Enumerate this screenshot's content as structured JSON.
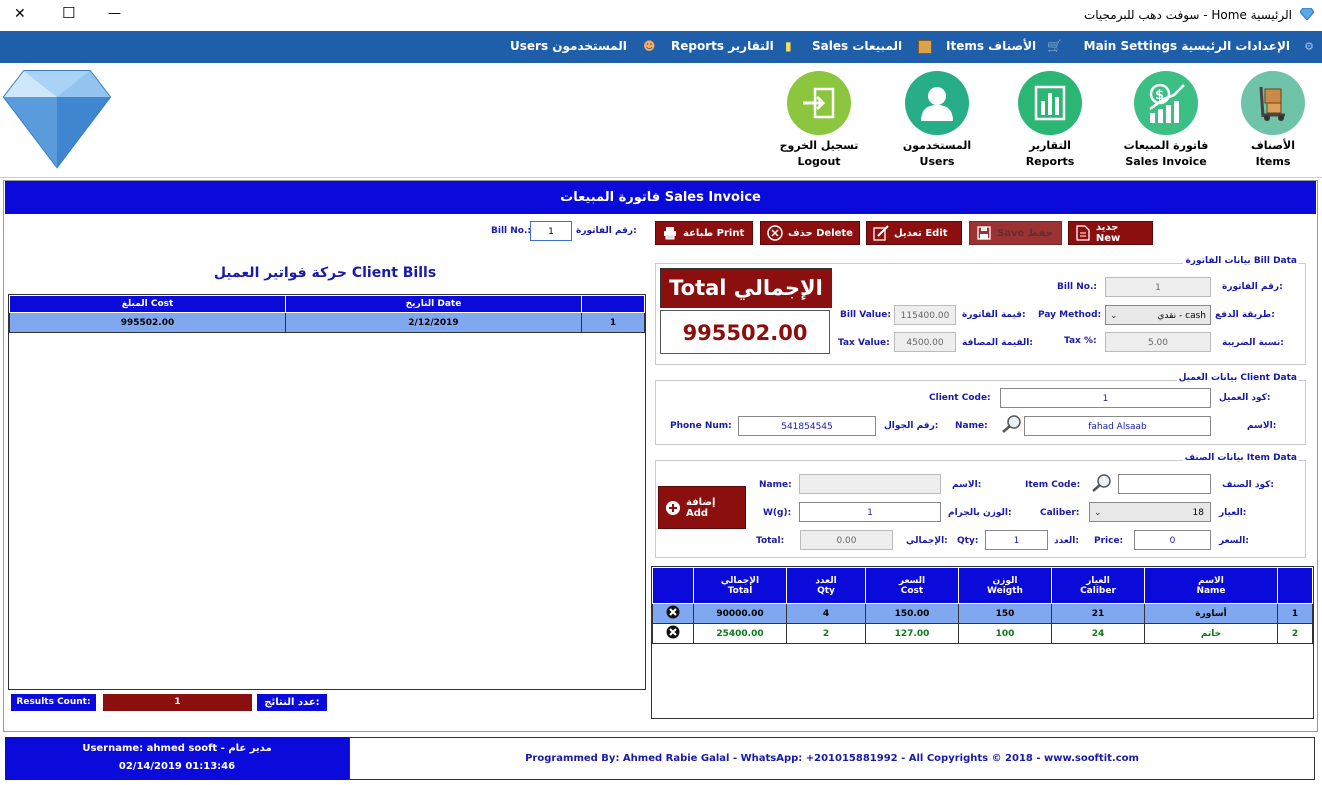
{
  "window": {
    "title": "الرئيسية Home - سوفت دهب للبرمجيات",
    "close": "✕",
    "maximize": "☐",
    "minimize": "—"
  },
  "menu": [
    {
      "label": "الإعدادات الرئيسية Main Settings"
    },
    {
      "label": "الأصناف Items"
    },
    {
      "label": "المبيعات Sales"
    },
    {
      "label": "التقارير Reports"
    },
    {
      "label": "المستخدمون Users"
    }
  ],
  "toolbar": [
    {
      "ar": "الأصناف",
      "en": "Items",
      "icon": "trolley-icon",
      "color": "#6fc3a8"
    },
    {
      "ar": "فاتورة المبيعات",
      "en": "Sales Invoice",
      "icon": "money-chart-icon",
      "color": "#3bbf85"
    },
    {
      "ar": "التقارير",
      "en": "Reports",
      "icon": "bar-chart-icon",
      "color": "#2cb673"
    },
    {
      "ar": "المستخدمون",
      "en": "Users",
      "icon": "user-icon",
      "color": "#27ad88"
    },
    {
      "ar": "تسجيل الخروج",
      "en": "Logout",
      "icon": "logout-icon",
      "color": "#8cc63f"
    }
  ],
  "page_title": "فاتورة المبيعات Sales Invoice",
  "actions": {
    "new": "جديد New",
    "save": "Save حفظ",
    "edit": "تعديل Edit",
    "delete": "حذف Delete",
    "print": "طباعة Print"
  },
  "search": {
    "label_ar": "رقم الفاتورة:",
    "label_en": "Bill No.:",
    "value": "1"
  },
  "bill_data": {
    "legend": "بيانات الفاتورة Bill Data",
    "bill_no_ar": "رقم الفاتورة:",
    "bill_no_en": "Bill No.:",
    "bill_no": "1",
    "pay_method_ar": "طريقة الدفع:",
    "pay_method_en": "Pay Method:",
    "pay_method": "نقدي - cash",
    "tax_rate_ar": "نسبة الضريبة:",
    "tax_rate_en": "Tax %:",
    "tax_rate": "5.00",
    "bill_value_ar": "قيمة الفاتورة:",
    "bill_value_en": "Bill Value:",
    "bill_value": "115400.00",
    "tax_value_ar": "القيمة المضافة:",
    "tax_value_en": "Tax Value:",
    "tax_value": "4500.00"
  },
  "total": {
    "label": "Total الإجمالي",
    "value": "995502.00"
  },
  "client_data": {
    "legend": "بيانات العميل Client Data",
    "code_ar": "كود العميل:",
    "code_en": "Client Code:",
    "code": "1",
    "name_ar": "الاسم:",
    "name_en": "Name:",
    "name": "fahad Alsaab",
    "phone_ar": "رقم الجوال:",
    "phone_en": "Phone Num:",
    "phone": "541854545"
  },
  "item_data": {
    "legend": "بيانات الصنف Item Data",
    "code_ar": "كود الصنف:",
    "code_en": "Item Code:",
    "code": "",
    "name_ar": "الاسم:",
    "name_en": "Name:",
    "name": "",
    "caliber_ar": "العيار:",
    "caliber_en": "Caliber:",
    "caliber": "18",
    "weight_ar": "الوزن بالجرام:",
    "weight_en": "W(g):",
    "weight": "1",
    "price_ar": "السعر:",
    "price_en": "Price:",
    "price": "0",
    "qty_ar": "العدد:",
    "qty_en": "Qty:",
    "qty": "1",
    "total_ar": "الإجمالي:",
    "total_en": "Total:",
    "total": "0.00",
    "add": "إضافة Add"
  },
  "items_table": {
    "headers": [
      {
        "ar": "",
        "en": ""
      },
      {
        "ar": "الاسم",
        "en": "Name"
      },
      {
        "ar": "العيار",
        "en": "Caliber"
      },
      {
        "ar": "الوزن",
        "en": "Weigth"
      },
      {
        "ar": "السعر",
        "en": "Cost"
      },
      {
        "ar": "العدد",
        "en": "Qty"
      },
      {
        "ar": "الإجمالي",
        "en": "Total"
      },
      {
        "ar": "",
        "en": ""
      }
    ],
    "rows": [
      {
        "n": "1",
        "name": "أساورة",
        "caliber": "21",
        "weight": "150",
        "cost": "150.00",
        "qty": "4",
        "total": "90000.00"
      },
      {
        "n": "2",
        "name": "خاتم",
        "caliber": "24",
        "weight": "100",
        "cost": "127.00",
        "qty": "2",
        "total": "25400.00"
      }
    ]
  },
  "client_bills": {
    "title": "حركة فواتير العميل Client Bills",
    "headers": [
      "",
      "التاريخ Date",
      "المبلغ Cost"
    ],
    "rows": [
      {
        "n": "1",
        "date": "2/12/2019",
        "cost": "995502.00"
      }
    ]
  },
  "results": {
    "label_en": "Results Count:",
    "label_ar": "عدد النتائج:",
    "value": "1"
  },
  "status": {
    "username": "Username: ahmed sooft - مدير عام",
    "datetime": "02/14/2019 01:13:46",
    "credits": "Programmed By: Ahmed Rabie Galal - WhatsApp: +201015881992 - All Copyrights © 2018 - www.sooftit.com"
  }
}
